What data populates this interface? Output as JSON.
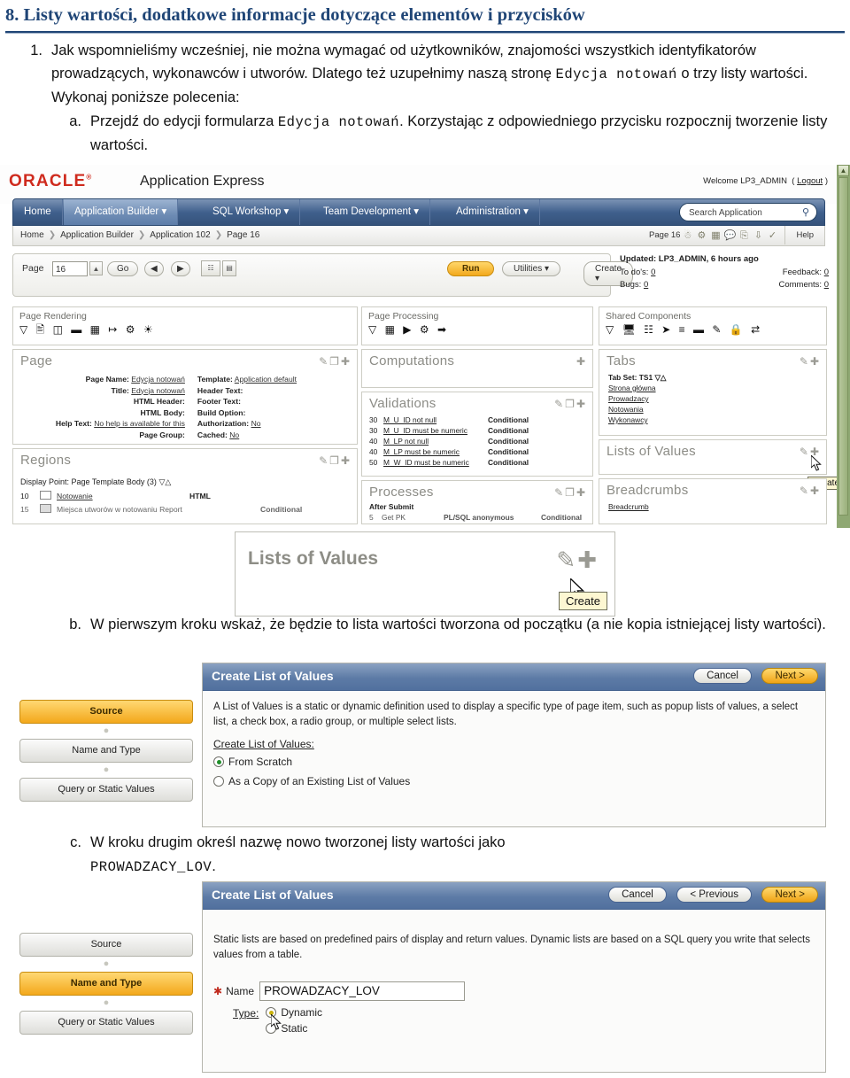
{
  "heading": "8. Listy wartości, dodatkowe informacje dotyczące elementów i przycisków",
  "theme": {
    "heading_color": "#1f4576",
    "accent_orange": "#f2a81c",
    "oracle_red": "#cf2b1e",
    "nav_blue": "#3f5f8c",
    "scroll_green": "#8fa873"
  },
  "list": {
    "item1": {
      "marker": "1.",
      "part_a": "Jak wspomnieliśmy wcześniej, nie można wymagać od użytkowników, znajomości wszystkich identyfikatorów prowadzących, wykonawców i utworów. Dlatego też uzupełnimy naszą stronę ",
      "mono_1": "Edycja notowań",
      "part_b": " o trzy listy wartości. Wykonaj poniższe polecenia:"
    },
    "sub_a": {
      "marker": "a.",
      "part_a": "Przejdź do edycji formularza ",
      "mono_1": "Edycja notowań",
      "part_b": ". Korzystając z odpowiedniego przycisku rozpocznij tworzenie listy wartości."
    },
    "sub_b": {
      "marker": "b.",
      "text": "W pierwszym kroku wskaż, że będzie to lista wartości tworzona od początku (a nie kopia istniejącej listy wartości)."
    },
    "sub_c": {
      "marker": "c.",
      "part_a": "W kroku drugim określ nazwę nowo tworzonej listy wartości jako ",
      "mono_1": "PROWADZACY_LOV",
      "part_b": "."
    }
  },
  "apex": {
    "logo": "ORACLE",
    "product": "Application Express",
    "welcome_prefix": "Welcome LP3_ADMIN",
    "logout": "Logout",
    "nav": [
      {
        "label": "Home",
        "has_caret": false,
        "active": false
      },
      {
        "label": "Application Builder",
        "has_caret": true,
        "active": true
      },
      {
        "label": "SQL Workshop",
        "has_caret": true,
        "active": false
      },
      {
        "label": "Team Development",
        "has_caret": true,
        "active": false
      },
      {
        "label": "Administration",
        "has_caret": true,
        "active": false
      }
    ],
    "search_placeholder": "Search Application",
    "breadcrumbs": [
      "Home",
      "Application Builder",
      "Application 102",
      "Page 16"
    ],
    "breadcrumb_right_page": "Page 16",
    "help_label": "Help",
    "toolbar": {
      "page_label": "Page",
      "page_value": "16",
      "go_label": "Go",
      "run_label": "Run",
      "utilities_label": "Utilities",
      "create_label": "Create"
    },
    "meta": {
      "updated": "Updated: LP3_ADMIN, 6 hours ago",
      "todos_label": "To do's:",
      "todos_value": "0",
      "feedback_label": "Feedback:",
      "feedback_value": "0",
      "bugs_label": "Bugs:",
      "bugs_value": "0",
      "comments_label": "Comments:",
      "comments_value": "0"
    },
    "panels": {
      "page_rendering": "Page Rendering",
      "page_processing": "Page Processing",
      "shared_components": "Shared Components"
    },
    "page_panel": {
      "title": "Page",
      "rows_left": [
        {
          "label": "Page Name:",
          "value": "Edycja notowań",
          "link": true
        },
        {
          "label": "Title:",
          "value": "Edycja notowań",
          "link": true
        },
        {
          "label": "HTML Header:",
          "value": "",
          "link": false
        },
        {
          "label": "HTML Body:",
          "value": "",
          "link": false
        },
        {
          "label": "Help Text:",
          "value": "No help is available for this",
          "link": true
        },
        {
          "label": "Page Group:",
          "value": "",
          "link": false
        }
      ],
      "rows_right": [
        {
          "label": "Template:",
          "value": "Application default",
          "link": true
        },
        {
          "label": "Header Text:",
          "value": "",
          "link": false
        },
        {
          "label": "Footer Text:",
          "value": "",
          "link": false
        },
        {
          "label": "Build Option:",
          "value": "",
          "link": false
        },
        {
          "label": "Authorization:",
          "value": "No",
          "link": true
        },
        {
          "label": "Cached:",
          "value": "No",
          "link": true
        }
      ]
    },
    "regions_panel": {
      "title": "Regions",
      "display_point": "Display Point: Page Template Body (3)",
      "rows": [
        {
          "seq": "10",
          "name": "Notowanie",
          "type": "HTML",
          "cond": ""
        },
        {
          "seq": "15",
          "name": "Miejsca utworów w notowaniu Report",
          "type": "",
          "cond": "Conditional"
        }
      ]
    },
    "computations_panel": {
      "title": "Computations"
    },
    "validations_panel": {
      "title": "Validations",
      "rows": [
        {
          "seq": "30",
          "name": "M_U_ID not null",
          "cond": "Conditional"
        },
        {
          "seq": "30",
          "name": "M_U_ID must be numeric",
          "cond": "Conditional"
        },
        {
          "seq": "40",
          "name": "M_LP not null",
          "cond": "Conditional"
        },
        {
          "seq": "40",
          "name": "M_LP must be numeric",
          "cond": "Conditional"
        },
        {
          "seq": "50",
          "name": "M_W_ID must be numeric",
          "cond": "Conditional"
        }
      ]
    },
    "processes_panel": {
      "title": "Processes",
      "group": "After Submit",
      "rows": [
        {
          "seq": "5",
          "name": "Get PK",
          "type": "PL/SQL anonymous",
          "cond": "Conditional"
        }
      ]
    },
    "tabs_panel": {
      "title": "Tabs",
      "tab_set": "Tab Set: TS1",
      "items": [
        "Strona główna",
        "Prowadzacy",
        "Notowania",
        "Wykonawcy"
      ]
    },
    "lov_panel": {
      "title": "Lists of Values",
      "tooltip": "Create"
    },
    "breadcrumbs_panel": {
      "title": "Breadcrumbs",
      "items": [
        "Breadcrumb"
      ]
    }
  },
  "lov_callout": {
    "title": "Lists of Values",
    "tooltip": "Create"
  },
  "wizard1": {
    "title": "Create List of Values",
    "buttons": [
      {
        "label": "Cancel",
        "primary": false
      },
      {
        "label": "Next >",
        "primary": true
      }
    ],
    "steps": [
      {
        "label": "Source",
        "active": true
      },
      {
        "label": "Name and Type",
        "active": false
      },
      {
        "label": "Query or Static Values",
        "active": false
      }
    ],
    "paragraph": "A List of Values is a static or dynamic definition used to display a specific type of page item, such as popup lists of values, a select list, a check box, a radio group, or multiple select lists.",
    "subtitle": "Create List of Values:",
    "options": [
      {
        "label": "From Scratch",
        "selected": true
      },
      {
        "label": "As a Copy of an Existing List of Values",
        "selected": false
      }
    ]
  },
  "wizard2": {
    "title": "Create List of Values",
    "buttons": [
      {
        "label": "Cancel",
        "primary": false
      },
      {
        "label": "< Previous",
        "primary": false
      },
      {
        "label": "Next >",
        "primary": true
      }
    ],
    "steps": [
      {
        "label": "Source",
        "active": false
      },
      {
        "label": "Name and Type",
        "active": true
      },
      {
        "label": "Query or Static Values",
        "active": false
      }
    ],
    "paragraph": "Static lists are based on predefined pairs of display and return values. Dynamic lists are based on a SQL query you write that selects values from a table.",
    "name_label": "Name",
    "name_value": "PROWADZACY_LOV",
    "type_label": "Type:",
    "type_options": [
      {
        "label": "Dynamic",
        "selected": true
      },
      {
        "label": "Static",
        "selected": false
      }
    ]
  }
}
